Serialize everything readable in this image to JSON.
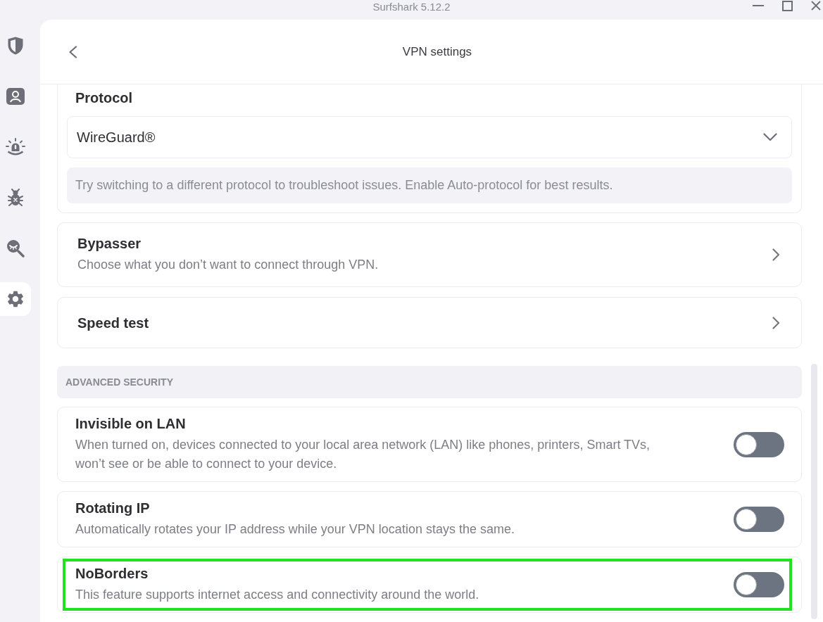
{
  "window": {
    "title": "Surfshark 5.12.2"
  },
  "sidebar": {
    "items": [
      {
        "selected": false
      },
      {
        "selected": false
      },
      {
        "selected": false
      },
      {
        "selected": false
      },
      {
        "selected": false
      },
      {
        "selected": true
      }
    ]
  },
  "header": {
    "title": "VPN settings"
  },
  "protocol": {
    "title": "Protocol",
    "value": "WireGuard®",
    "note": "Try switching to a different protocol to troubleshoot issues. Enable Auto-protocol for best results."
  },
  "links": [
    {
      "title": "Bypasser",
      "description": "Choose what you don’t want to connect through VPN."
    },
    {
      "title": "Speed test"
    }
  ],
  "advanced_security": {
    "title": "ADVANCED SECURITY",
    "settings": [
      {
        "title": "Invisible on LAN",
        "description": "When turned on, devices connected to your local area network (LAN) like phones, printers, Smart TVs, won’t see or be able to connect to your device.",
        "on": false,
        "highlighted": false
      },
      {
        "title": "Rotating IP",
        "description": "Automatically rotates your IP address while your VPN location stays the same.",
        "on": false,
        "highlighted": false
      },
      {
        "title": "NoBorders",
        "description": "This feature supports internet access and connectivity around the world.",
        "on": false,
        "highlighted": true
      }
    ]
  }
}
